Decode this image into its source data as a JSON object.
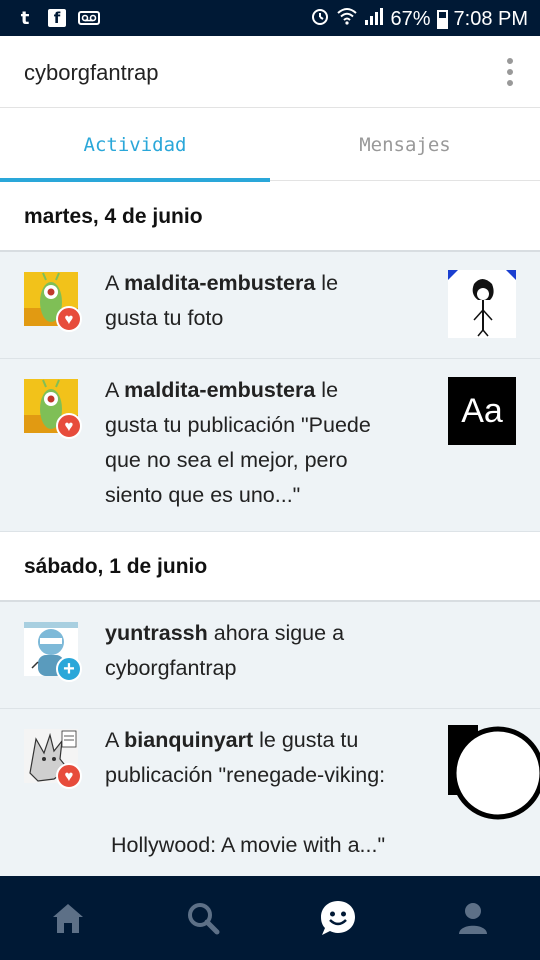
{
  "status_bar": {
    "battery": "67%",
    "time": "7:08 PM",
    "icons": [
      "tumblr-icon",
      "facebook-icon",
      "voicemail-icon",
      "alarm-icon",
      "wifi-icon",
      "signal-icon",
      "battery-icon"
    ]
  },
  "header": {
    "title": "cyborgfantrap",
    "menu_icon": "kebab-menu-icon"
  },
  "tabs": [
    {
      "label": "Actividad",
      "active": true
    },
    {
      "label": "Mensajes",
      "active": false
    }
  ],
  "sections": [
    {
      "date": "martes, 4 de junio",
      "items": [
        {
          "prefix": "A ",
          "user": "maldita-embustera",
          "line_rest": " le",
          "line2": "gusta tu foto",
          "badge": "heart-icon",
          "thumb": "drawing-thumbnail"
        },
        {
          "prefix": "A ",
          "user": "maldita-embustera",
          "line_rest": " le",
          "line2": "gusta tu publicación \"Puede",
          "line3": "que no sea el mejor, pero",
          "line4": "siento que es uno...\"",
          "badge": "heart-icon",
          "thumb_text": "Aa"
        }
      ]
    },
    {
      "date": "sábado, 1 de junio",
      "items": [
        {
          "user": "yuntrassh",
          "line_rest": " ahora sigue a",
          "line2": "cyborgfantrap",
          "badge": "plus-icon"
        },
        {
          "prefix": "A ",
          "user": "bianquinyart",
          "line_rest": " le gusta tu",
          "line2": "publicación \"renegade-viking:",
          "line3": "Hollywood: A movie with a...\"",
          "badge": "heart-icon",
          "thumb": "circle-thumbnail"
        }
      ]
    }
  ],
  "bottom_nav": [
    "home-icon",
    "search-icon",
    "activity-smiley-icon",
    "account-icon"
  ],
  "colors": {
    "navy": "#001935",
    "accent": "#2aa7d9",
    "heart": "#e74c3c",
    "item_bg": "#eef3f6"
  }
}
